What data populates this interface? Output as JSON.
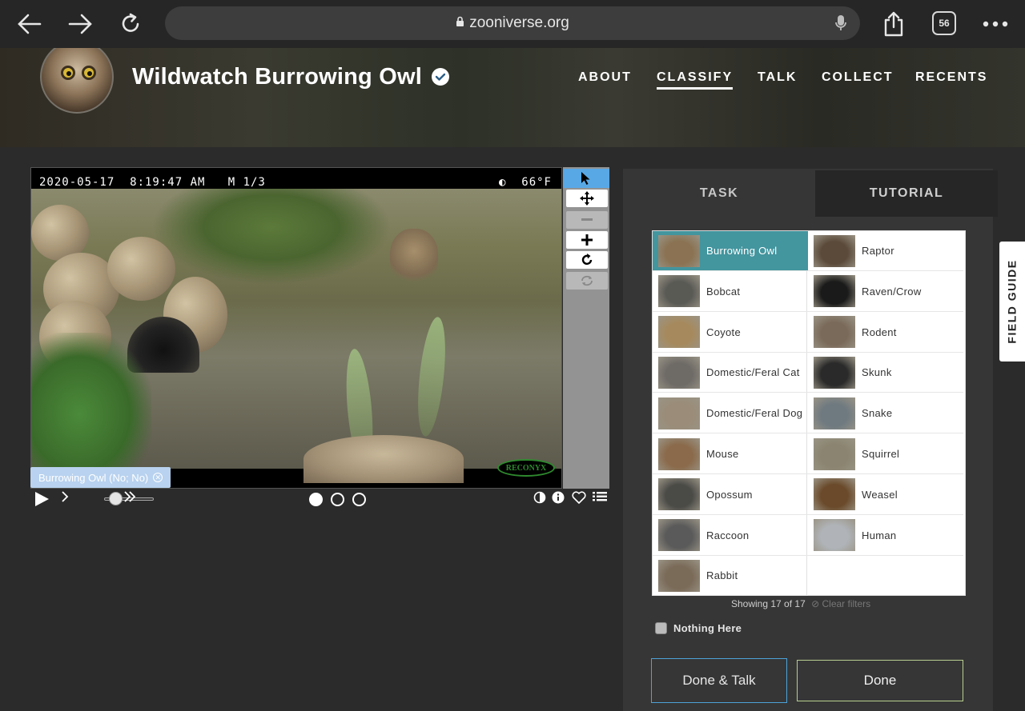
{
  "browser": {
    "url": "zooniverse.org",
    "tab_count": "56"
  },
  "project": {
    "title": "Wildwatch Burrowing Owl",
    "nav": [
      {
        "label": "ABOUT",
        "active": false
      },
      {
        "label": "CLASSIFY",
        "active": true
      },
      {
        "label": "TALK",
        "active": false
      },
      {
        "label": "COLLECT",
        "active": false
      },
      {
        "label": "RECENTS",
        "active": false
      }
    ]
  },
  "subject": {
    "timestamp": "2020-05-17  8:19:47 AM   M 1/3",
    "temperature": "◐  66°F",
    "watermark": "RECONYX",
    "annotation_chip": "Burrowing Owl (No; No)"
  },
  "frames": {
    "count": 3,
    "current": 1
  },
  "task": {
    "tabs": [
      "TASK",
      "TUTORIAL"
    ],
    "choices": [
      {
        "label": "Burrowing Owl",
        "selected": true,
        "color": "#8a7252"
      },
      {
        "label": "Raptor",
        "selected": false,
        "color": "#5b4a3a"
      },
      {
        "label": "Bobcat",
        "selected": false,
        "color": "#5a5a55"
      },
      {
        "label": "Raven/Crow",
        "selected": false,
        "color": "#1a1a1a"
      },
      {
        "label": "Coyote",
        "selected": false,
        "color": "#a68a5e"
      },
      {
        "label": "Rodent",
        "selected": false,
        "color": "#7a6a5a"
      },
      {
        "label": "Domestic/Feral Cat",
        "selected": false,
        "color": "#6e6a66"
      },
      {
        "label": "Skunk",
        "selected": false,
        "color": "#2a2a2a"
      },
      {
        "label": "Domestic/Feral Dog",
        "selected": false,
        "color": "#9a8c78"
      },
      {
        "label": "Snake",
        "selected": false,
        "color": "#6f7a80"
      },
      {
        "label": "Mouse",
        "selected": false,
        "color": "#8a6a4a"
      },
      {
        "label": "Squirrel",
        "selected": false,
        "color": "#8a8470"
      },
      {
        "label": "Opossum",
        "selected": false,
        "color": "#4a4a46"
      },
      {
        "label": "Weasel",
        "selected": false,
        "color": "#6a4a2a"
      },
      {
        "label": "Raccoon",
        "selected": false,
        "color": "#5a5a5a"
      },
      {
        "label": "Human",
        "selected": false,
        "color": "#b0b4b8"
      },
      {
        "label": "Rabbit",
        "selected": false,
        "color": "#7a6a58"
      }
    ],
    "showing": "Showing 17 of 17",
    "clear_filters": "Clear filters",
    "nothing_here": "Nothing Here",
    "done_talk": "Done & Talk",
    "done": "Done"
  },
  "field_guide": "FIELD GUIDE"
}
